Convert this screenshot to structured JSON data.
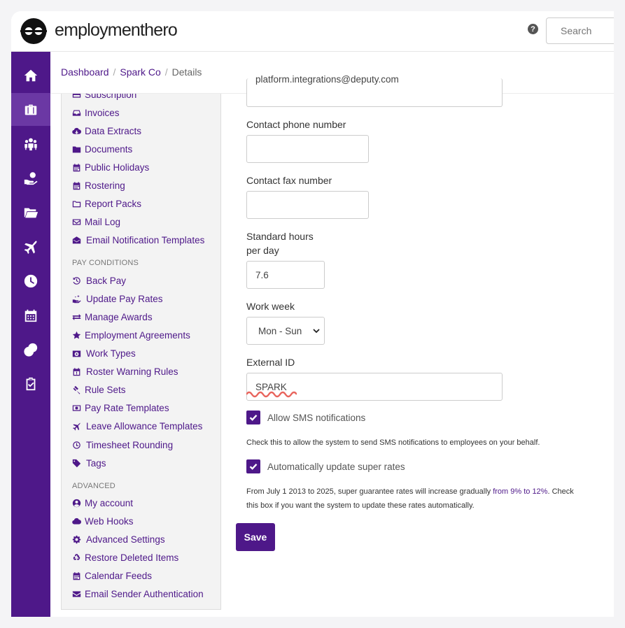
{
  "brand": {
    "name": "employmenthero"
  },
  "header": {
    "help_label": "?",
    "search_placeholder": "Search"
  },
  "rail": {
    "items": [
      {
        "icon": "home-icon"
      },
      {
        "icon": "briefcase-icon",
        "active": true
      },
      {
        "icon": "people-icon"
      },
      {
        "icon": "hand-money-icon"
      },
      {
        "icon": "folder-icon"
      },
      {
        "icon": "plane-icon"
      },
      {
        "icon": "clock-icon"
      },
      {
        "icon": "calendar-icon"
      },
      {
        "icon": "coins-icon"
      },
      {
        "icon": "clipboard-check-icon"
      }
    ]
  },
  "breadcrumb": {
    "items": [
      "Dashboard",
      "Spark Co"
    ],
    "current": "Details"
  },
  "sidenav": {
    "items_top": [
      {
        "label": "Subscription",
        "icon": "card-icon"
      },
      {
        "label": "Invoices",
        "icon": "inbox-icon"
      },
      {
        "label": "Data Extracts",
        "icon": "cloud-download-icon"
      },
      {
        "label": "Documents",
        "icon": "folder-icon"
      },
      {
        "label": "Public Holidays",
        "icon": "calendar-icon"
      },
      {
        "label": "Rostering",
        "icon": "calendar-icon"
      },
      {
        "label": "Report Packs",
        "icon": "folder-outline-icon"
      },
      {
        "label": "Mail Log",
        "icon": "envelope-outline-icon"
      },
      {
        "label": "Email Notification Templates",
        "icon": "envelope-open-icon"
      }
    ],
    "pay_conditions_heading": "PAY CONDITIONS",
    "pay_conditions": [
      {
        "label": "Back Pay",
        "icon": "history-icon"
      },
      {
        "label": "Update Pay Rates",
        "icon": "hand-sparkle-icon"
      },
      {
        "label": "Manage Awards",
        "icon": "exchange-icon"
      },
      {
        "label": "Employment Agreements",
        "icon": "star-icon"
      },
      {
        "label": "Work Types",
        "icon": "camera-icon"
      },
      {
        "label": "Roster Warning Rules",
        "icon": "calendar-warning-icon"
      },
      {
        "label": "Rule Sets",
        "icon": "gavel-icon"
      },
      {
        "label": "Pay Rate Templates",
        "icon": "money-icon"
      },
      {
        "label": "Leave Allowance Templates",
        "icon": "plane-icon"
      },
      {
        "label": "Timesheet Rounding",
        "icon": "clock-icon"
      },
      {
        "label": "Tags",
        "icon": "tag-icon"
      }
    ],
    "advanced_heading": "ADVANCED",
    "advanced": [
      {
        "label": "My account",
        "icon": "user-circle-icon"
      },
      {
        "label": "Web Hooks",
        "icon": "cloud-icon"
      },
      {
        "label": "Advanced Settings",
        "icon": "gear-icon"
      },
      {
        "label": "Restore Deleted Items",
        "icon": "recycle-icon"
      },
      {
        "label": "Calendar Feeds",
        "icon": "calendar-icon"
      },
      {
        "label": "Email Sender Authentication",
        "icon": "envelope-icon"
      }
    ]
  },
  "form": {
    "email_value": "platform.integrations@deputy.com",
    "phone_label": "Contact phone number",
    "phone_value": "",
    "fax_label": "Contact fax number",
    "fax_value": "",
    "hours_label_line1": "Standard hours",
    "hours_label_line2": "per day",
    "hours_value": "7.6",
    "work_week_label": "Work week",
    "work_week_value": "Mon - Sun",
    "external_id_label": "External ID",
    "external_id_value": "SPARK",
    "sms_label": "Allow SMS notifications",
    "sms_checked": true,
    "sms_help": "Check this to allow the system to send SMS notifications to employees on your behalf.",
    "super_label": "Automatically update super rates",
    "super_checked": true,
    "super_help_1": "From July 1 2013 to 2025, super guarantee rates will increase gradually",
    "super_help_link": "from 9% to 12%",
    "super_help_2": ". Check",
    "super_help_3": "this box if you want the system to update these rates automatically.",
    "save_label": "Save"
  },
  "colors": {
    "brand_purple": "#4e1889",
    "rail_active": "#6b38a4"
  }
}
